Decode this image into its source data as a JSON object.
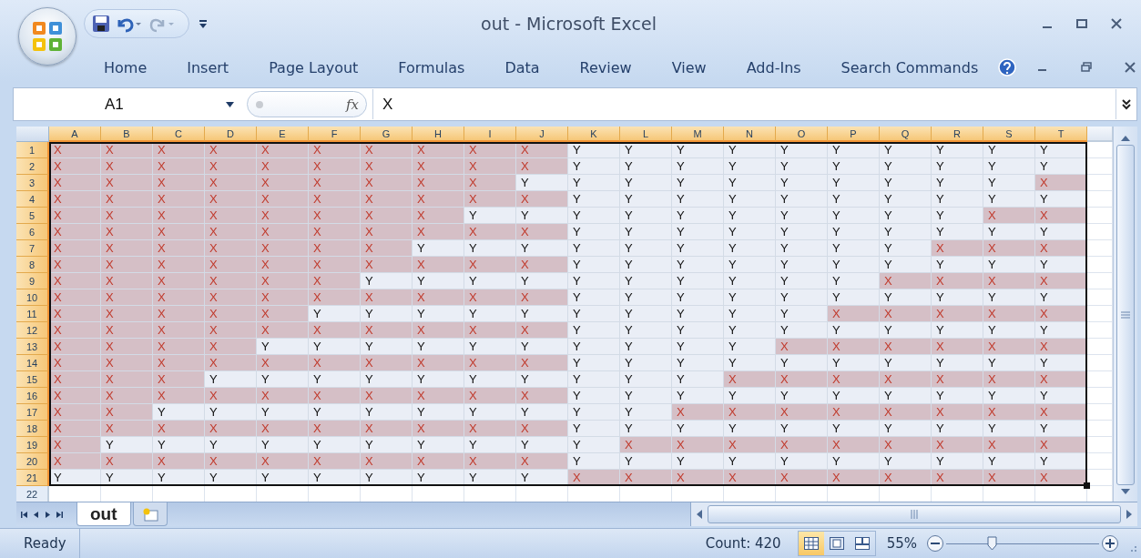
{
  "window": {
    "title": "out - Microsoft Excel"
  },
  "ribbon_tabs": [
    "Home",
    "Insert",
    "Page Layout",
    "Formulas",
    "Data",
    "Review",
    "View",
    "Add-Ins",
    "Search Commands"
  ],
  "name_box": "A1",
  "function_button": "fx",
  "formula": "X",
  "columns": [
    "A",
    "B",
    "C",
    "D",
    "E",
    "F",
    "G",
    "H",
    "I",
    "J",
    "K",
    "L",
    "M",
    "N",
    "O",
    "P",
    "Q",
    "R",
    "S",
    "T"
  ],
  "rows": [
    {
      "header": "1",
      "cells": [
        {
          "v": "X",
          "kind": "marked"
        },
        {
          "v": "X",
          "kind": "marked"
        },
        {
          "v": "X",
          "kind": "marked"
        },
        {
          "v": "X",
          "kind": "marked"
        },
        {
          "v": "X",
          "kind": "marked"
        },
        {
          "v": "X",
          "kind": "marked"
        },
        {
          "v": "X",
          "kind": "marked"
        },
        {
          "v": "X",
          "kind": "marked"
        },
        {
          "v": "X",
          "kind": "marked"
        },
        {
          "v": "X",
          "kind": "marked"
        },
        {
          "v": "Y",
          "kind": "plain"
        },
        {
          "v": "Y",
          "kind": "plain"
        },
        {
          "v": "Y",
          "kind": "plain"
        },
        {
          "v": "Y",
          "kind": "plain"
        },
        {
          "v": "Y",
          "kind": "plain"
        },
        {
          "v": "Y",
          "kind": "plain"
        },
        {
          "v": "Y",
          "kind": "plain"
        },
        {
          "v": "Y",
          "kind": "plain"
        },
        {
          "v": "Y",
          "kind": "plain"
        },
        {
          "v": "Y",
          "kind": "plain"
        }
      ]
    },
    {
      "header": "2",
      "cells": [
        {
          "v": "X",
          "kind": "marked"
        },
        {
          "v": "X",
          "kind": "marked"
        },
        {
          "v": "X",
          "kind": "marked"
        },
        {
          "v": "X",
          "kind": "marked"
        },
        {
          "v": "X",
          "kind": "marked"
        },
        {
          "v": "X",
          "kind": "marked"
        },
        {
          "v": "X",
          "kind": "marked"
        },
        {
          "v": "X",
          "kind": "marked"
        },
        {
          "v": "X",
          "kind": "marked"
        },
        {
          "v": "X",
          "kind": "marked"
        },
        {
          "v": "Y",
          "kind": "plain"
        },
        {
          "v": "Y",
          "kind": "plain"
        },
        {
          "v": "Y",
          "kind": "plain"
        },
        {
          "v": "Y",
          "kind": "plain"
        },
        {
          "v": "Y",
          "kind": "plain"
        },
        {
          "v": "Y",
          "kind": "plain"
        },
        {
          "v": "Y",
          "kind": "plain"
        },
        {
          "v": "Y",
          "kind": "plain"
        },
        {
          "v": "Y",
          "kind": "plain"
        },
        {
          "v": "Y",
          "kind": "plain"
        }
      ]
    },
    {
      "header": "3",
      "cells": [
        {
          "v": "X",
          "kind": "marked"
        },
        {
          "v": "X",
          "kind": "marked"
        },
        {
          "v": "X",
          "kind": "marked"
        },
        {
          "v": "X",
          "kind": "marked"
        },
        {
          "v": "X",
          "kind": "marked"
        },
        {
          "v": "X",
          "kind": "marked"
        },
        {
          "v": "X",
          "kind": "marked"
        },
        {
          "v": "X",
          "kind": "marked"
        },
        {
          "v": "X",
          "kind": "marked"
        },
        {
          "v": "Y",
          "kind": "plain"
        },
        {
          "v": "Y",
          "kind": "plain"
        },
        {
          "v": "Y",
          "kind": "plain"
        },
        {
          "v": "Y",
          "kind": "plain"
        },
        {
          "v": "Y",
          "kind": "plain"
        },
        {
          "v": "Y",
          "kind": "plain"
        },
        {
          "v": "Y",
          "kind": "plain"
        },
        {
          "v": "Y",
          "kind": "plain"
        },
        {
          "v": "Y",
          "kind": "plain"
        },
        {
          "v": "Y",
          "kind": "plain"
        },
        {
          "v": "X",
          "kind": "marked"
        }
      ]
    },
    {
      "header": "4",
      "cells": [
        {
          "v": "X",
          "kind": "marked"
        },
        {
          "v": "X",
          "kind": "marked"
        },
        {
          "v": "X",
          "kind": "marked"
        },
        {
          "v": "X",
          "kind": "marked"
        },
        {
          "v": "X",
          "kind": "marked"
        },
        {
          "v": "X",
          "kind": "marked"
        },
        {
          "v": "X",
          "kind": "marked"
        },
        {
          "v": "X",
          "kind": "marked"
        },
        {
          "v": "X",
          "kind": "marked"
        },
        {
          "v": "X",
          "kind": "marked"
        },
        {
          "v": "Y",
          "kind": "plain"
        },
        {
          "v": "Y",
          "kind": "plain"
        },
        {
          "v": "Y",
          "kind": "plain"
        },
        {
          "v": "Y",
          "kind": "plain"
        },
        {
          "v": "Y",
          "kind": "plain"
        },
        {
          "v": "Y",
          "kind": "plain"
        },
        {
          "v": "Y",
          "kind": "plain"
        },
        {
          "v": "Y",
          "kind": "plain"
        },
        {
          "v": "Y",
          "kind": "plain"
        },
        {
          "v": "Y",
          "kind": "plain"
        }
      ]
    },
    {
      "header": "5",
      "cells": [
        {
          "v": "X",
          "kind": "marked"
        },
        {
          "v": "X",
          "kind": "marked"
        },
        {
          "v": "X",
          "kind": "marked"
        },
        {
          "v": "X",
          "kind": "marked"
        },
        {
          "v": "X",
          "kind": "marked"
        },
        {
          "v": "X",
          "kind": "marked"
        },
        {
          "v": "X",
          "kind": "marked"
        },
        {
          "v": "X",
          "kind": "marked"
        },
        {
          "v": "Y",
          "kind": "plain"
        },
        {
          "v": "Y",
          "kind": "plain"
        },
        {
          "v": "Y",
          "kind": "plain"
        },
        {
          "v": "Y",
          "kind": "plain"
        },
        {
          "v": "Y",
          "kind": "plain"
        },
        {
          "v": "Y",
          "kind": "plain"
        },
        {
          "v": "Y",
          "kind": "plain"
        },
        {
          "v": "Y",
          "kind": "plain"
        },
        {
          "v": "Y",
          "kind": "plain"
        },
        {
          "v": "Y",
          "kind": "plain"
        },
        {
          "v": "X",
          "kind": "marked"
        },
        {
          "v": "X",
          "kind": "marked"
        }
      ]
    },
    {
      "header": "6",
      "cells": [
        {
          "v": "X",
          "kind": "marked"
        },
        {
          "v": "X",
          "kind": "marked"
        },
        {
          "v": "X",
          "kind": "marked"
        },
        {
          "v": "X",
          "kind": "marked"
        },
        {
          "v": "X",
          "kind": "marked"
        },
        {
          "v": "X",
          "kind": "marked"
        },
        {
          "v": "X",
          "kind": "marked"
        },
        {
          "v": "X",
          "kind": "marked"
        },
        {
          "v": "X",
          "kind": "marked"
        },
        {
          "v": "X",
          "kind": "marked"
        },
        {
          "v": "Y",
          "kind": "plain"
        },
        {
          "v": "Y",
          "kind": "plain"
        },
        {
          "v": "Y",
          "kind": "plain"
        },
        {
          "v": "Y",
          "kind": "plain"
        },
        {
          "v": "Y",
          "kind": "plain"
        },
        {
          "v": "Y",
          "kind": "plain"
        },
        {
          "v": "Y",
          "kind": "plain"
        },
        {
          "v": "Y",
          "kind": "plain"
        },
        {
          "v": "Y",
          "kind": "plain"
        },
        {
          "v": "Y",
          "kind": "plain"
        }
      ]
    },
    {
      "header": "7",
      "cells": [
        {
          "v": "X",
          "kind": "marked"
        },
        {
          "v": "X",
          "kind": "marked"
        },
        {
          "v": "X",
          "kind": "marked"
        },
        {
          "v": "X",
          "kind": "marked"
        },
        {
          "v": "X",
          "kind": "marked"
        },
        {
          "v": "X",
          "kind": "marked"
        },
        {
          "v": "X",
          "kind": "marked"
        },
        {
          "v": "Y",
          "kind": "plain"
        },
        {
          "v": "Y",
          "kind": "plain"
        },
        {
          "v": "Y",
          "kind": "plain"
        },
        {
          "v": "Y",
          "kind": "plain"
        },
        {
          "v": "Y",
          "kind": "plain"
        },
        {
          "v": "Y",
          "kind": "plain"
        },
        {
          "v": "Y",
          "kind": "plain"
        },
        {
          "v": "Y",
          "kind": "plain"
        },
        {
          "v": "Y",
          "kind": "plain"
        },
        {
          "v": "Y",
          "kind": "plain"
        },
        {
          "v": "X",
          "kind": "marked"
        },
        {
          "v": "X",
          "kind": "marked"
        },
        {
          "v": "X",
          "kind": "marked"
        }
      ]
    },
    {
      "header": "8",
      "cells": [
        {
          "v": "X",
          "kind": "marked"
        },
        {
          "v": "X",
          "kind": "marked"
        },
        {
          "v": "X",
          "kind": "marked"
        },
        {
          "v": "X",
          "kind": "marked"
        },
        {
          "v": "X",
          "kind": "marked"
        },
        {
          "v": "X",
          "kind": "marked"
        },
        {
          "v": "X",
          "kind": "marked"
        },
        {
          "v": "X",
          "kind": "marked"
        },
        {
          "v": "X",
          "kind": "marked"
        },
        {
          "v": "X",
          "kind": "marked"
        },
        {
          "v": "Y",
          "kind": "plain"
        },
        {
          "v": "Y",
          "kind": "plain"
        },
        {
          "v": "Y",
          "kind": "plain"
        },
        {
          "v": "Y",
          "kind": "plain"
        },
        {
          "v": "Y",
          "kind": "plain"
        },
        {
          "v": "Y",
          "kind": "plain"
        },
        {
          "v": "Y",
          "kind": "plain"
        },
        {
          "v": "Y",
          "kind": "plain"
        },
        {
          "v": "Y",
          "kind": "plain"
        },
        {
          "v": "Y",
          "kind": "plain"
        }
      ]
    },
    {
      "header": "9",
      "cells": [
        {
          "v": "X",
          "kind": "marked"
        },
        {
          "v": "X",
          "kind": "marked"
        },
        {
          "v": "X",
          "kind": "marked"
        },
        {
          "v": "X",
          "kind": "marked"
        },
        {
          "v": "X",
          "kind": "marked"
        },
        {
          "v": "X",
          "kind": "marked"
        },
        {
          "v": "Y",
          "kind": "plain"
        },
        {
          "v": "Y",
          "kind": "plain"
        },
        {
          "v": "Y",
          "kind": "plain"
        },
        {
          "v": "Y",
          "kind": "plain"
        },
        {
          "v": "Y",
          "kind": "plain"
        },
        {
          "v": "Y",
          "kind": "plain"
        },
        {
          "v": "Y",
          "kind": "plain"
        },
        {
          "v": "Y",
          "kind": "plain"
        },
        {
          "v": "Y",
          "kind": "plain"
        },
        {
          "v": "Y",
          "kind": "plain"
        },
        {
          "v": "X",
          "kind": "marked"
        },
        {
          "v": "X",
          "kind": "marked"
        },
        {
          "v": "X",
          "kind": "marked"
        },
        {
          "v": "X",
          "kind": "marked"
        }
      ]
    },
    {
      "header": "10",
      "cells": [
        {
          "v": "X",
          "kind": "marked"
        },
        {
          "v": "X",
          "kind": "marked"
        },
        {
          "v": "X",
          "kind": "marked"
        },
        {
          "v": "X",
          "kind": "marked"
        },
        {
          "v": "X",
          "kind": "marked"
        },
        {
          "v": "X",
          "kind": "marked"
        },
        {
          "v": "X",
          "kind": "marked"
        },
        {
          "v": "X",
          "kind": "marked"
        },
        {
          "v": "X",
          "kind": "marked"
        },
        {
          "v": "X",
          "kind": "marked"
        },
        {
          "v": "Y",
          "kind": "plain"
        },
        {
          "v": "Y",
          "kind": "plain"
        },
        {
          "v": "Y",
          "kind": "plain"
        },
        {
          "v": "Y",
          "kind": "plain"
        },
        {
          "v": "Y",
          "kind": "plain"
        },
        {
          "v": "Y",
          "kind": "plain"
        },
        {
          "v": "Y",
          "kind": "plain"
        },
        {
          "v": "Y",
          "kind": "plain"
        },
        {
          "v": "Y",
          "kind": "plain"
        },
        {
          "v": "Y",
          "kind": "plain"
        }
      ]
    },
    {
      "header": "11",
      "cells": [
        {
          "v": "X",
          "kind": "marked"
        },
        {
          "v": "X",
          "kind": "marked"
        },
        {
          "v": "X",
          "kind": "marked"
        },
        {
          "v": "X",
          "kind": "marked"
        },
        {
          "v": "X",
          "kind": "marked"
        },
        {
          "v": "Y",
          "kind": "plain"
        },
        {
          "v": "Y",
          "kind": "plain"
        },
        {
          "v": "Y",
          "kind": "plain"
        },
        {
          "v": "Y",
          "kind": "plain"
        },
        {
          "v": "Y",
          "kind": "plain"
        },
        {
          "v": "Y",
          "kind": "plain"
        },
        {
          "v": "Y",
          "kind": "plain"
        },
        {
          "v": "Y",
          "kind": "plain"
        },
        {
          "v": "Y",
          "kind": "plain"
        },
        {
          "v": "Y",
          "kind": "plain"
        },
        {
          "v": "X",
          "kind": "marked"
        },
        {
          "v": "X",
          "kind": "marked"
        },
        {
          "v": "X",
          "kind": "marked"
        },
        {
          "v": "X",
          "kind": "marked"
        },
        {
          "v": "X",
          "kind": "marked"
        }
      ]
    },
    {
      "header": "12",
      "cells": [
        {
          "v": "X",
          "kind": "marked"
        },
        {
          "v": "X",
          "kind": "marked"
        },
        {
          "v": "X",
          "kind": "marked"
        },
        {
          "v": "X",
          "kind": "marked"
        },
        {
          "v": "X",
          "kind": "marked"
        },
        {
          "v": "X",
          "kind": "marked"
        },
        {
          "v": "X",
          "kind": "marked"
        },
        {
          "v": "X",
          "kind": "marked"
        },
        {
          "v": "X",
          "kind": "marked"
        },
        {
          "v": "X",
          "kind": "marked"
        },
        {
          "v": "Y",
          "kind": "plain"
        },
        {
          "v": "Y",
          "kind": "plain"
        },
        {
          "v": "Y",
          "kind": "plain"
        },
        {
          "v": "Y",
          "kind": "plain"
        },
        {
          "v": "Y",
          "kind": "plain"
        },
        {
          "v": "Y",
          "kind": "plain"
        },
        {
          "v": "Y",
          "kind": "plain"
        },
        {
          "v": "Y",
          "kind": "plain"
        },
        {
          "v": "Y",
          "kind": "plain"
        },
        {
          "v": "Y",
          "kind": "plain"
        }
      ]
    },
    {
      "header": "13",
      "cells": [
        {
          "v": "X",
          "kind": "marked"
        },
        {
          "v": "X",
          "kind": "marked"
        },
        {
          "v": "X",
          "kind": "marked"
        },
        {
          "v": "X",
          "kind": "marked"
        },
        {
          "v": "Y",
          "kind": "plain"
        },
        {
          "v": "Y",
          "kind": "plain"
        },
        {
          "v": "Y",
          "kind": "plain"
        },
        {
          "v": "Y",
          "kind": "plain"
        },
        {
          "v": "Y",
          "kind": "plain"
        },
        {
          "v": "Y",
          "kind": "plain"
        },
        {
          "v": "Y",
          "kind": "plain"
        },
        {
          "v": "Y",
          "kind": "plain"
        },
        {
          "v": "Y",
          "kind": "plain"
        },
        {
          "v": "Y",
          "kind": "plain"
        },
        {
          "v": "X",
          "kind": "marked"
        },
        {
          "v": "X",
          "kind": "marked"
        },
        {
          "v": "X",
          "kind": "marked"
        },
        {
          "v": "X",
          "kind": "marked"
        },
        {
          "v": "X",
          "kind": "marked"
        },
        {
          "v": "X",
          "kind": "marked"
        }
      ]
    },
    {
      "header": "14",
      "cells": [
        {
          "v": "X",
          "kind": "marked"
        },
        {
          "v": "X",
          "kind": "marked"
        },
        {
          "v": "X",
          "kind": "marked"
        },
        {
          "v": "X",
          "kind": "marked"
        },
        {
          "v": "X",
          "kind": "marked"
        },
        {
          "v": "X",
          "kind": "marked"
        },
        {
          "v": "X",
          "kind": "marked"
        },
        {
          "v": "X",
          "kind": "marked"
        },
        {
          "v": "X",
          "kind": "marked"
        },
        {
          "v": "X",
          "kind": "marked"
        },
        {
          "v": "Y",
          "kind": "plain"
        },
        {
          "v": "Y",
          "kind": "plain"
        },
        {
          "v": "Y",
          "kind": "plain"
        },
        {
          "v": "Y",
          "kind": "plain"
        },
        {
          "v": "Y",
          "kind": "plain"
        },
        {
          "v": "Y",
          "kind": "plain"
        },
        {
          "v": "Y",
          "kind": "plain"
        },
        {
          "v": "Y",
          "kind": "plain"
        },
        {
          "v": "Y",
          "kind": "plain"
        },
        {
          "v": "Y",
          "kind": "plain"
        }
      ]
    },
    {
      "header": "15",
      "cells": [
        {
          "v": "X",
          "kind": "marked"
        },
        {
          "v": "X",
          "kind": "marked"
        },
        {
          "v": "X",
          "kind": "marked"
        },
        {
          "v": "Y",
          "kind": "plain"
        },
        {
          "v": "Y",
          "kind": "plain"
        },
        {
          "v": "Y",
          "kind": "plain"
        },
        {
          "v": "Y",
          "kind": "plain"
        },
        {
          "v": "Y",
          "kind": "plain"
        },
        {
          "v": "Y",
          "kind": "plain"
        },
        {
          "v": "Y",
          "kind": "plain"
        },
        {
          "v": "Y",
          "kind": "plain"
        },
        {
          "v": "Y",
          "kind": "plain"
        },
        {
          "v": "Y",
          "kind": "plain"
        },
        {
          "v": "X",
          "kind": "marked"
        },
        {
          "v": "X",
          "kind": "marked"
        },
        {
          "v": "X",
          "kind": "marked"
        },
        {
          "v": "X",
          "kind": "marked"
        },
        {
          "v": "X",
          "kind": "marked"
        },
        {
          "v": "X",
          "kind": "marked"
        },
        {
          "v": "X",
          "kind": "marked"
        }
      ]
    },
    {
      "header": "16",
      "cells": [
        {
          "v": "X",
          "kind": "marked"
        },
        {
          "v": "X",
          "kind": "marked"
        },
        {
          "v": "X",
          "kind": "marked"
        },
        {
          "v": "X",
          "kind": "marked"
        },
        {
          "v": "X",
          "kind": "marked"
        },
        {
          "v": "X",
          "kind": "marked"
        },
        {
          "v": "X",
          "kind": "marked"
        },
        {
          "v": "X",
          "kind": "marked"
        },
        {
          "v": "X",
          "kind": "marked"
        },
        {
          "v": "X",
          "kind": "marked"
        },
        {
          "v": "Y",
          "kind": "plain"
        },
        {
          "v": "Y",
          "kind": "plain"
        },
        {
          "v": "Y",
          "kind": "plain"
        },
        {
          "v": "Y",
          "kind": "plain"
        },
        {
          "v": "Y",
          "kind": "plain"
        },
        {
          "v": "Y",
          "kind": "plain"
        },
        {
          "v": "Y",
          "kind": "plain"
        },
        {
          "v": "Y",
          "kind": "plain"
        },
        {
          "v": "Y",
          "kind": "plain"
        },
        {
          "v": "Y",
          "kind": "plain"
        }
      ]
    },
    {
      "header": "17",
      "cells": [
        {
          "v": "X",
          "kind": "marked"
        },
        {
          "v": "X",
          "kind": "marked"
        },
        {
          "v": "Y",
          "kind": "plain"
        },
        {
          "v": "Y",
          "kind": "plain"
        },
        {
          "v": "Y",
          "kind": "plain"
        },
        {
          "v": "Y",
          "kind": "plain"
        },
        {
          "v": "Y",
          "kind": "plain"
        },
        {
          "v": "Y",
          "kind": "plain"
        },
        {
          "v": "Y",
          "kind": "plain"
        },
        {
          "v": "Y",
          "kind": "plain"
        },
        {
          "v": "Y",
          "kind": "plain"
        },
        {
          "v": "Y",
          "kind": "plain"
        },
        {
          "v": "X",
          "kind": "marked"
        },
        {
          "v": "X",
          "kind": "marked"
        },
        {
          "v": "X",
          "kind": "marked"
        },
        {
          "v": "X",
          "kind": "marked"
        },
        {
          "v": "X",
          "kind": "marked"
        },
        {
          "v": "X",
          "kind": "marked"
        },
        {
          "v": "X",
          "kind": "marked"
        },
        {
          "v": "X",
          "kind": "marked"
        }
      ]
    },
    {
      "header": "18",
      "cells": [
        {
          "v": "X",
          "kind": "marked"
        },
        {
          "v": "X",
          "kind": "marked"
        },
        {
          "v": "X",
          "kind": "marked"
        },
        {
          "v": "X",
          "kind": "marked"
        },
        {
          "v": "X",
          "kind": "marked"
        },
        {
          "v": "X",
          "kind": "marked"
        },
        {
          "v": "X",
          "kind": "marked"
        },
        {
          "v": "X",
          "kind": "marked"
        },
        {
          "v": "X",
          "kind": "marked"
        },
        {
          "v": "X",
          "kind": "marked"
        },
        {
          "v": "Y",
          "kind": "plain"
        },
        {
          "v": "Y",
          "kind": "plain"
        },
        {
          "v": "Y",
          "kind": "plain"
        },
        {
          "v": "Y",
          "kind": "plain"
        },
        {
          "v": "Y",
          "kind": "plain"
        },
        {
          "v": "Y",
          "kind": "plain"
        },
        {
          "v": "Y",
          "kind": "plain"
        },
        {
          "v": "Y",
          "kind": "plain"
        },
        {
          "v": "Y",
          "kind": "plain"
        },
        {
          "v": "Y",
          "kind": "plain"
        }
      ]
    },
    {
      "header": "19",
      "cells": [
        {
          "v": "X",
          "kind": "marked"
        },
        {
          "v": "Y",
          "kind": "plain"
        },
        {
          "v": "Y",
          "kind": "plain"
        },
        {
          "v": "Y",
          "kind": "plain"
        },
        {
          "v": "Y",
          "kind": "plain"
        },
        {
          "v": "Y",
          "kind": "plain"
        },
        {
          "v": "Y",
          "kind": "plain"
        },
        {
          "v": "Y",
          "kind": "plain"
        },
        {
          "v": "Y",
          "kind": "plain"
        },
        {
          "v": "Y",
          "kind": "plain"
        },
        {
          "v": "Y",
          "kind": "plain"
        },
        {
          "v": "X",
          "kind": "marked"
        },
        {
          "v": "X",
          "kind": "marked"
        },
        {
          "v": "X",
          "kind": "marked"
        },
        {
          "v": "X",
          "kind": "marked"
        },
        {
          "v": "X",
          "kind": "marked"
        },
        {
          "v": "X",
          "kind": "marked"
        },
        {
          "v": "X",
          "kind": "marked"
        },
        {
          "v": "X",
          "kind": "marked"
        },
        {
          "v": "X",
          "kind": "marked"
        }
      ]
    },
    {
      "header": "20",
      "cells": [
        {
          "v": "X",
          "kind": "marked"
        },
        {
          "v": "X",
          "kind": "marked"
        },
        {
          "v": "X",
          "kind": "marked"
        },
        {
          "v": "X",
          "kind": "marked"
        },
        {
          "v": "X",
          "kind": "marked"
        },
        {
          "v": "X",
          "kind": "marked"
        },
        {
          "v": "X",
          "kind": "marked"
        },
        {
          "v": "X",
          "kind": "marked"
        },
        {
          "v": "X",
          "kind": "marked"
        },
        {
          "v": "X",
          "kind": "marked"
        },
        {
          "v": "Y",
          "kind": "plain"
        },
        {
          "v": "Y",
          "kind": "plain"
        },
        {
          "v": "Y",
          "kind": "plain"
        },
        {
          "v": "Y",
          "kind": "plain"
        },
        {
          "v": "Y",
          "kind": "plain"
        },
        {
          "v": "Y",
          "kind": "plain"
        },
        {
          "v": "Y",
          "kind": "plain"
        },
        {
          "v": "Y",
          "kind": "plain"
        },
        {
          "v": "Y",
          "kind": "plain"
        },
        {
          "v": "Y",
          "kind": "plain"
        }
      ]
    },
    {
      "header": "21",
      "cells": [
        {
          "v": "Y",
          "kind": "plain"
        },
        {
          "v": "Y",
          "kind": "plain"
        },
        {
          "v": "Y",
          "kind": "plain"
        },
        {
          "v": "Y",
          "kind": "plain"
        },
        {
          "v": "Y",
          "kind": "plain"
        },
        {
          "v": "Y",
          "kind": "plain"
        },
        {
          "v": "Y",
          "kind": "plain"
        },
        {
          "v": "Y",
          "kind": "plain"
        },
        {
          "v": "Y",
          "kind": "plain"
        },
        {
          "v": "Y",
          "kind": "plain"
        },
        {
          "v": "X",
          "kind": "marked"
        },
        {
          "v": "X",
          "kind": "marked"
        },
        {
          "v": "X",
          "kind": "marked"
        },
        {
          "v": "X",
          "kind": "marked"
        },
        {
          "v": "X",
          "kind": "marked"
        },
        {
          "v": "X",
          "kind": "marked"
        },
        {
          "v": "X",
          "kind": "marked"
        },
        {
          "v": "X",
          "kind": "marked"
        },
        {
          "v": "X",
          "kind": "marked"
        },
        {
          "v": "X",
          "kind": "marked"
        }
      ]
    }
  ],
  "empty_rows": [
    "22"
  ],
  "sheet_tabs": [
    {
      "label": "out",
      "selected": true
    }
  ],
  "status_bar": {
    "mode": "Ready",
    "count": "Count: 420",
    "views": [
      {
        "kind": "normal",
        "selected": true
      },
      {
        "kind": "page-layout",
        "selected": false
      },
      {
        "kind": "page-break",
        "selected": false
      }
    ],
    "zoom": "55%",
    "zoom_slider": {
      "level": 0.3
    }
  }
}
